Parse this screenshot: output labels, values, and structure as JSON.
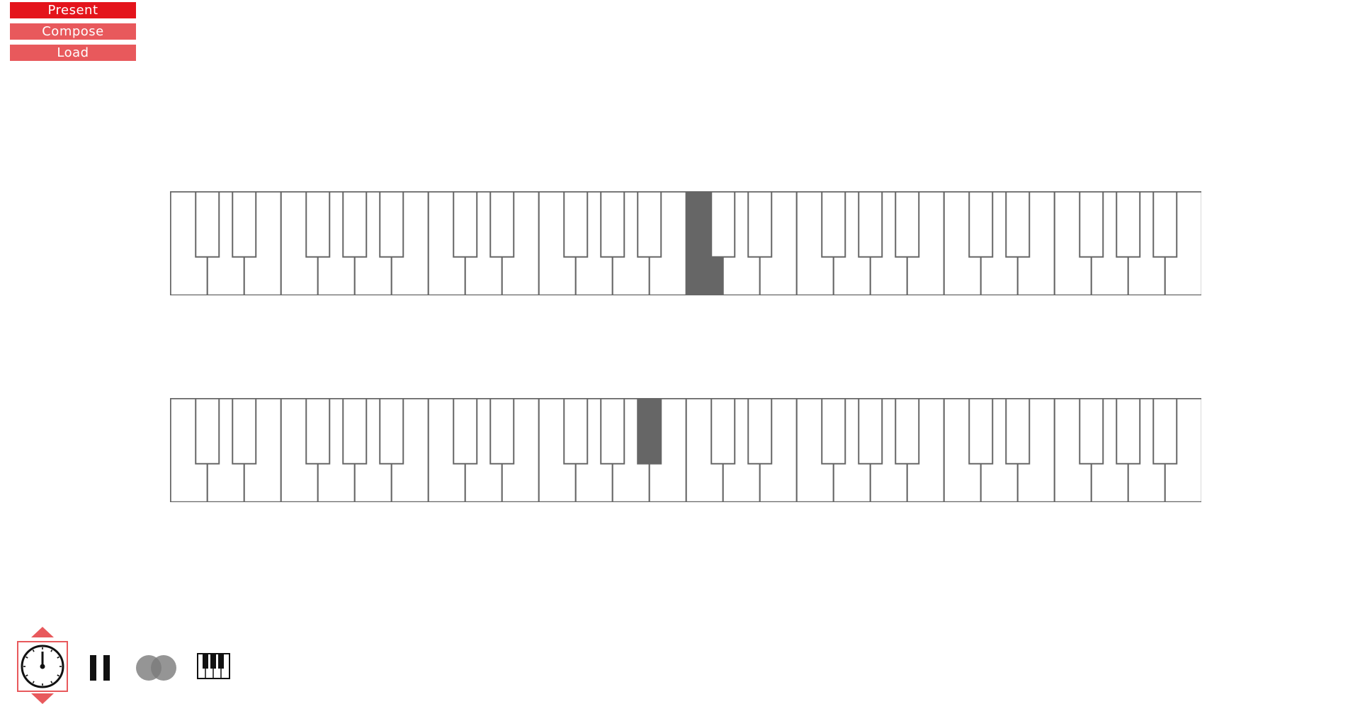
{
  "modes": [
    {
      "label": "Present",
      "state": "active"
    },
    {
      "label": "Compose",
      "state": "inactive"
    },
    {
      "label": "Load",
      "state": "inactive"
    }
  ],
  "colors": {
    "accent_active": "#e4141b",
    "accent_inactive": "#e8595c",
    "key_outline": "#666666",
    "key_highlight": "#666666"
  },
  "keyboards": [
    {
      "name": "upper-keyboard",
      "white_keys": 28,
      "highlighted": {
        "type": "white",
        "index": 14
      }
    },
    {
      "name": "lower-keyboard",
      "white_keys": 28,
      "highlighted": {
        "type": "black",
        "after_white_index": 12
      }
    }
  ],
  "toolbar": {
    "icons": [
      "tempo-up-icon",
      "clock-icon",
      "tempo-down-icon",
      "pause-icon",
      "overlap-circles-icon",
      "piano-keys-icon"
    ]
  }
}
